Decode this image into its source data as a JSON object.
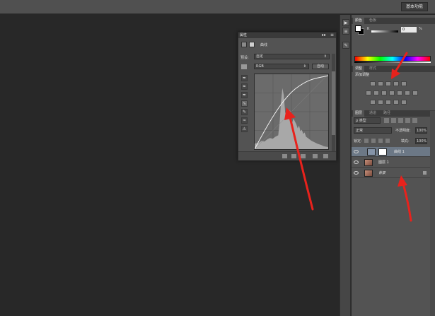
{
  "app": {
    "workspace_button": "基本功能"
  },
  "color_panel": {
    "tabs": [
      "颜色",
      "色板"
    ],
    "channel_label": "K",
    "channel_value": "0",
    "channel_unit": "%"
  },
  "adjustments_panel": {
    "tabs": [
      "调整",
      "样式"
    ],
    "title": "添加调整"
  },
  "layers_panel": {
    "tabs": [
      "图层",
      "通道",
      "路径"
    ],
    "filter_label": "ρ 类型",
    "blend_mode": "正常",
    "opacity_label": "不透明度:",
    "opacity_value": "100%",
    "lock_label": "锁定:",
    "fill_label": "填充:",
    "fill_value": "100%",
    "layers": [
      {
        "name": "曲线 1",
        "selected": true
      },
      {
        "name": "图层 1",
        "selected": false
      },
      {
        "name": "背景",
        "selected": false,
        "locked": true
      }
    ]
  },
  "properties_panel": {
    "tab": "属性",
    "header_label": "曲线",
    "preset_label": "预设:",
    "preset_value": "自定",
    "channel_value": "RGB",
    "auto_button": "自动"
  },
  "colors": {
    "arrow": "#e8221c",
    "selected_layer": "#6c7886"
  }
}
